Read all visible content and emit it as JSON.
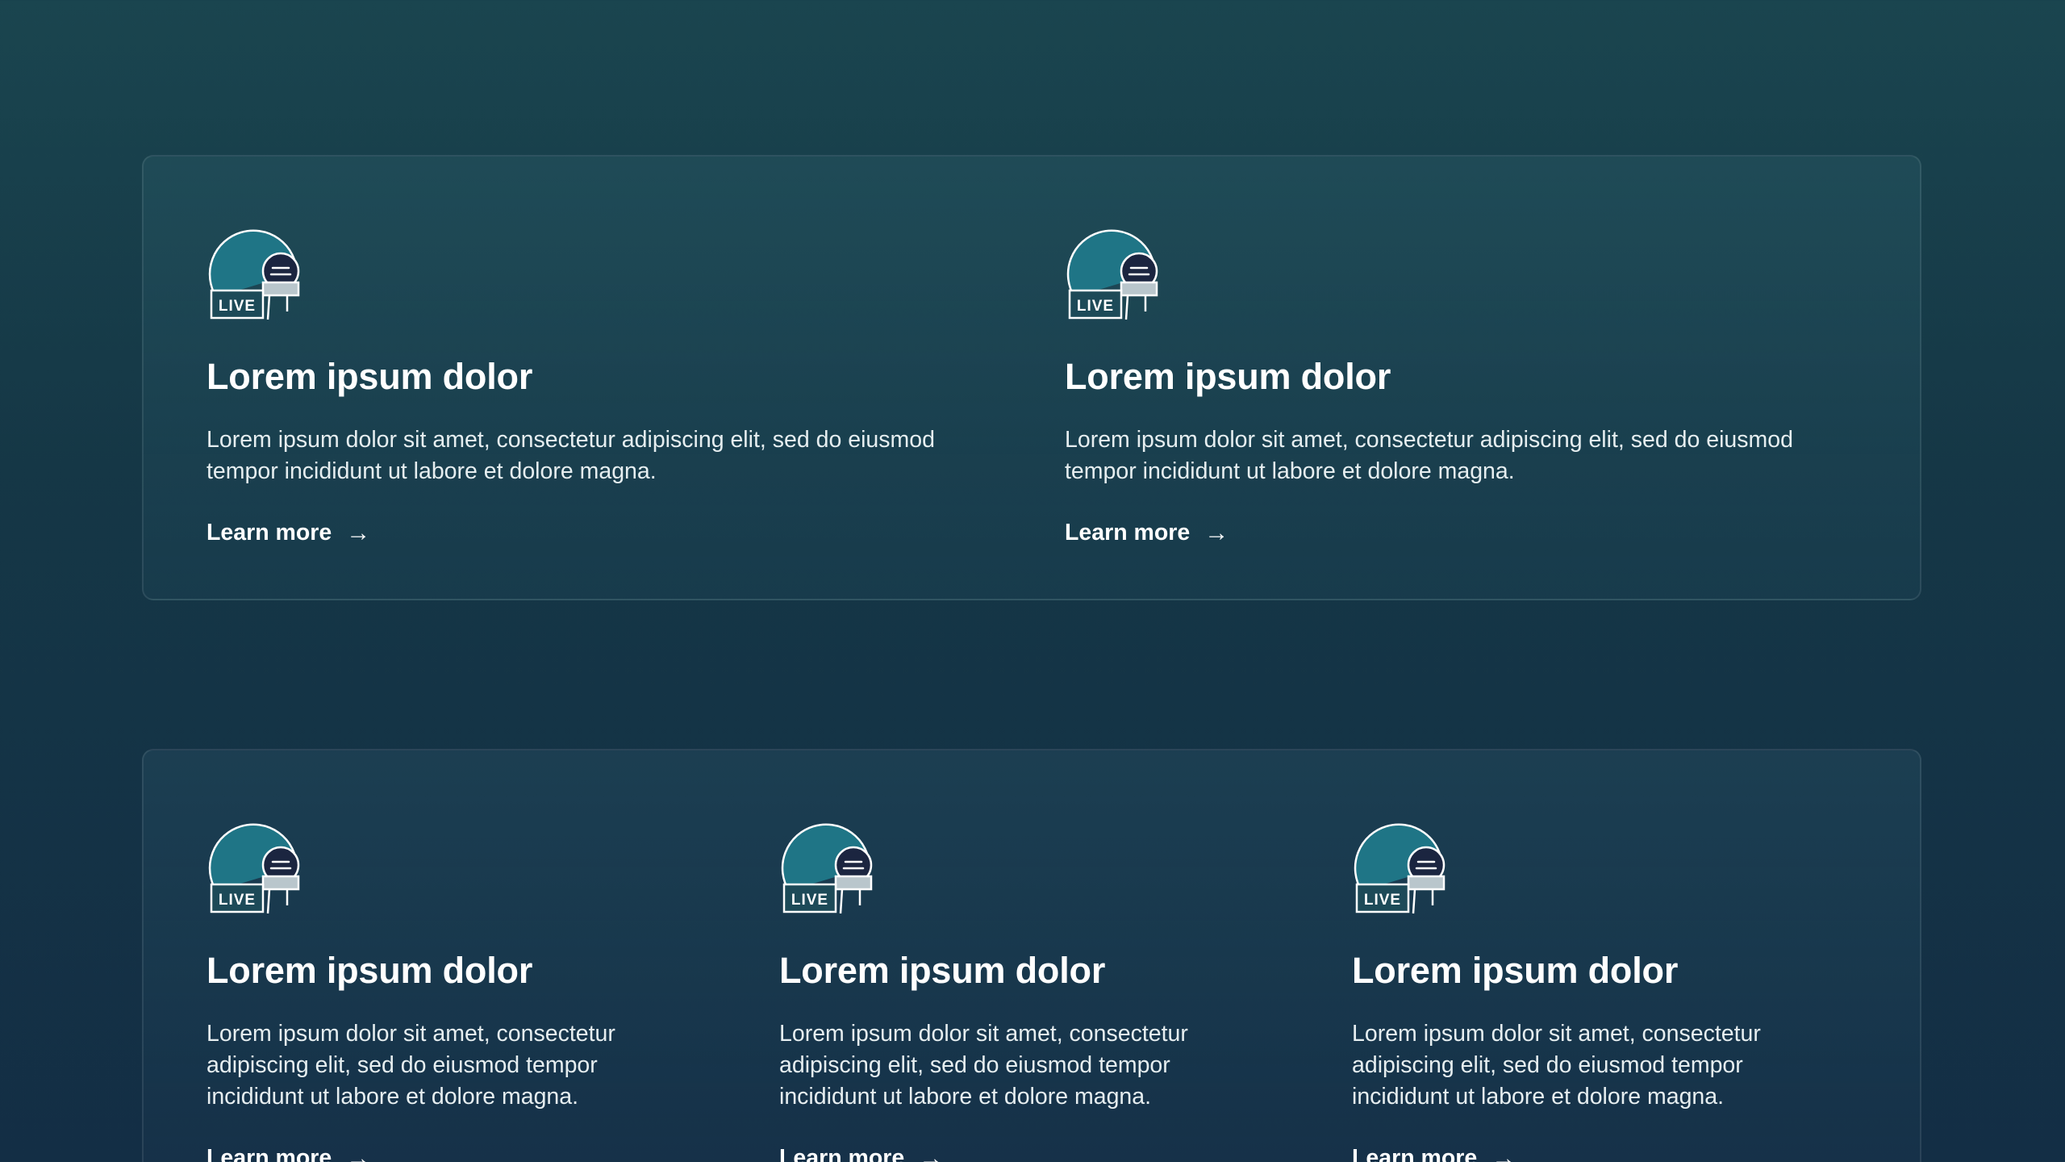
{
  "panels": [
    {
      "cards": [
        {
          "icon": "live-podcast-icon",
          "badge": "LIVE",
          "title": "Lorem ipsum dolor",
          "body": "Lorem ipsum dolor sit amet, consectetur adipiscing elit, sed do eiusmod tempor incididunt ut labore et dolore magna.",
          "link": "Learn more",
          "arrow": "→"
        },
        {
          "icon": "live-podcast-icon",
          "badge": "LIVE",
          "title": "Lorem ipsum dolor",
          "body": "Lorem ipsum dolor sit amet, consectetur adipiscing elit, sed do eiusmod tempor incididunt ut labore et dolore magna.",
          "link": "Learn more",
          "arrow": "→"
        }
      ]
    },
    {
      "cards": [
        {
          "icon": "live-podcast-icon",
          "badge": "LIVE",
          "title": "Lorem ipsum dolor",
          "body": "Lorem ipsum dolor sit amet, consectetur adipiscing elit, sed do eiusmod tempor incididunt ut labore et dolore magna.",
          "link": "Learn more",
          "arrow": "→"
        },
        {
          "icon": "live-podcast-icon",
          "badge": "LIVE",
          "title": "Lorem ipsum dolor",
          "body": "Lorem ipsum dolor sit amet, consectetur adipiscing elit, sed do eiusmod tempor incididunt ut labore et dolore magna.",
          "link": "Learn more",
          "arrow": "→"
        },
        {
          "icon": "live-podcast-icon",
          "badge": "LIVE",
          "title": "Lorem ipsum dolor",
          "body": "Lorem ipsum dolor sit amet, consectetur adipiscing elit, sed do eiusmod tempor incididunt ut labore et dolore magna.",
          "link": "Learn more",
          "arrow": "→"
        }
      ]
    }
  ],
  "colors": {
    "accent": "#1f7586",
    "background_top": "#1a454f",
    "background_bottom": "#132e45",
    "icon_dark": "#1b2540"
  }
}
